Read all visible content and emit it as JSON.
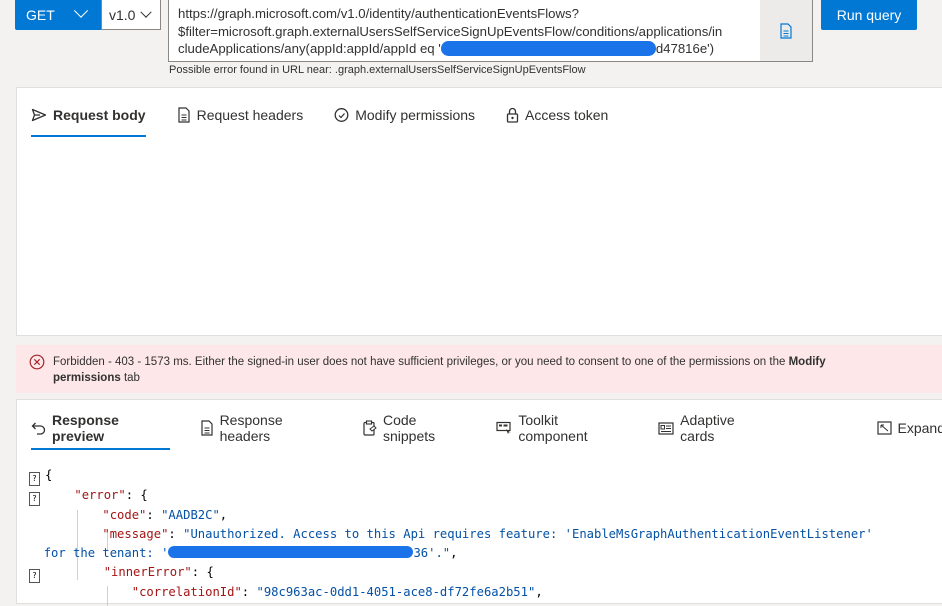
{
  "toolbar": {
    "method": "GET",
    "version": "v1.0",
    "url_line1": "https://graph.microsoft.com/v1.0/identity/authenticationEventsFlows?",
    "url_line2": "$filter=microsoft.graph.externalUsersSelfServiceSignUpEventsFlow/conditions/applications/in",
    "url_line3a": "cludeApplications/any(appId:appId/appId eq '",
    "url_line3b": "d47816e')",
    "url_warning": "Possible error found in URL near: .graph.externalUsersSelfServiceSignUpEventsFlow",
    "run_label": "Run query"
  },
  "request_tabs": [
    {
      "label": "Request body",
      "icon": "send-icon"
    },
    {
      "label": "Request headers",
      "icon": "document-icon"
    },
    {
      "label": "Modify permissions",
      "icon": "shield-icon"
    },
    {
      "label": "Access token",
      "icon": "lock-icon"
    }
  ],
  "error": {
    "text_a": "Forbidden - 403 - 1573 ms. Either the signed-in user does not have sufficient privileges, or you need to consent to one of the permissions on the ",
    "bold_a": "Modify",
    "bold_b": "permissions",
    "text_b": " tab"
  },
  "response_tabs": [
    {
      "label": "Response preview",
      "icon": "undo-icon"
    },
    {
      "label": "Response headers",
      "icon": "document-icon"
    },
    {
      "label": "Code snippets",
      "icon": "clipboard-icon"
    },
    {
      "label": "Toolkit component",
      "icon": "component-icon"
    },
    {
      "label": "Adaptive cards",
      "icon": "card-icon"
    },
    {
      "label": "Expand",
      "icon": "expand-icon"
    }
  ],
  "response": {
    "open_brace": "{",
    "error_key": "\"error\"",
    "code_key": "\"code\"",
    "code_val": "\"AADB2C\"",
    "message_key": "\"message\"",
    "message_val": "\"Unauthorized. Access to this Api requires feature: 'EnableMsGraphAuthenticationEventListener'",
    "message_cont_a": "for the tenant: '",
    "message_cont_b": "36'.\"",
    "inner_key": "\"innerError\"",
    "corr_key": "\"correlationId\"",
    "corr_val": "\"98c963ac-0dd1-4051-ace8-df72fe6a2b51\""
  },
  "colors": {
    "accent": "#0078d4",
    "error_bg": "#fde7e9",
    "error_icon": "#a4262c"
  }
}
